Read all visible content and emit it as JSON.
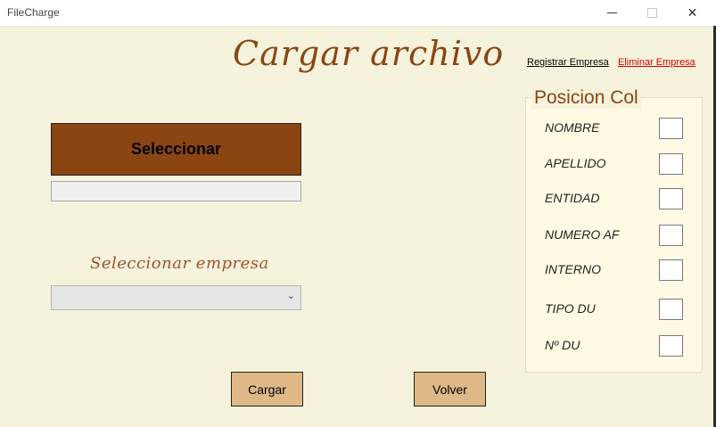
{
  "window": {
    "title": "FileCharge",
    "controls": [
      "minimize-icon",
      "maximize-icon",
      "close-icon"
    ]
  },
  "header": {
    "title": "Cargar archivo"
  },
  "links": {
    "register": "Registrar Empresa",
    "delete": "Eliminar Empresa"
  },
  "file": {
    "select_label": "Seleccionar",
    "path_value": ""
  },
  "company": {
    "label": "Seleccionar empresa",
    "selected": ""
  },
  "actions": {
    "load": "Cargar",
    "back": "Volver"
  },
  "columns": {
    "title": "Posicion Col",
    "fields": [
      {
        "label": "NOMBRE",
        "value": ""
      },
      {
        "label": "APELLIDO",
        "value": ""
      },
      {
        "label": "ENTIDAD",
        "value": ""
      },
      {
        "label": "NUMERO AF",
        "value": ""
      },
      {
        "label": "INTERNO",
        "value": ""
      },
      {
        "label": "TIPO DU",
        "value": ""
      },
      {
        "label": "Nº DU",
        "value": ""
      }
    ]
  },
  "colors": {
    "accent": "#8b4513",
    "button": "#deb887",
    "background": "#f5f3dc",
    "danger_link": "#d20000"
  }
}
